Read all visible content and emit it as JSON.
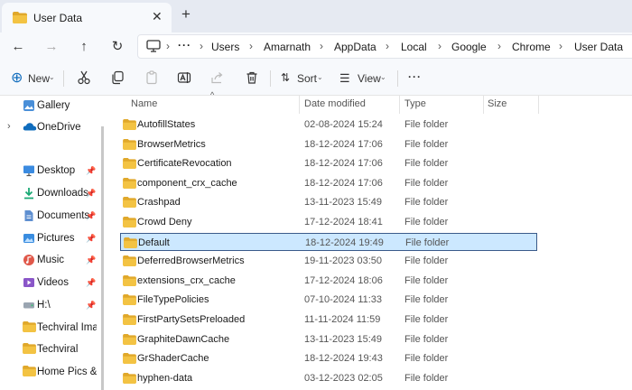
{
  "tab": {
    "title": "User Data"
  },
  "nav": {
    "more_crumbs": "···"
  },
  "breadcrumb": [
    "Users",
    "Amarnath",
    "AppData",
    "Local",
    "Google",
    "Chrome",
    "User Data"
  ],
  "toolbar": {
    "new_label": "New",
    "sort_label": "Sort",
    "view_label": "View",
    "more_label": "···"
  },
  "sidebar": {
    "items": [
      {
        "label": "Gallery",
        "icon": "gallery-icon",
        "pinned": false
      },
      {
        "label": "OneDrive",
        "icon": "cloud-icon",
        "pinned": false,
        "expandable": true
      },
      {
        "label": "Desktop",
        "icon": "desktop-icon",
        "pinned": true
      },
      {
        "label": "Downloads",
        "icon": "download-icon",
        "pinned": true
      },
      {
        "label": "Documents",
        "icon": "documents-icon",
        "pinned": true
      },
      {
        "label": "Pictures",
        "icon": "pictures-icon",
        "pinned": true
      },
      {
        "label": "Music",
        "icon": "music-icon",
        "pinned": true
      },
      {
        "label": "Videos",
        "icon": "videos-icon",
        "pinned": true
      },
      {
        "label": "H:\\",
        "icon": "drive-icon",
        "pinned": true
      },
      {
        "label": "Techviral Image",
        "icon": "folder-icon",
        "pinned": false
      },
      {
        "label": "Techviral",
        "icon": "folder-icon",
        "pinned": false
      },
      {
        "label": "Home Pics & Tc",
        "icon": "folder-icon",
        "pinned": false
      }
    ]
  },
  "columns": {
    "name": "Name",
    "date": "Date modified",
    "type": "Type",
    "size": "Size"
  },
  "files": [
    {
      "name": "AutofillStates",
      "date": "02-08-2024 15:24",
      "type": "File folder"
    },
    {
      "name": "BrowserMetrics",
      "date": "18-12-2024 17:06",
      "type": "File folder"
    },
    {
      "name": "CertificateRevocation",
      "date": "18-12-2024 17:06",
      "type": "File folder"
    },
    {
      "name": "component_crx_cache",
      "date": "18-12-2024 17:06",
      "type": "File folder"
    },
    {
      "name": "Crashpad",
      "date": "13-11-2023 15:49",
      "type": "File folder"
    },
    {
      "name": "Crowd Deny",
      "date": "17-12-2024 18:41",
      "type": "File folder"
    },
    {
      "name": "Default",
      "date": "18-12-2024 19:49",
      "type": "File folder",
      "selected": true
    },
    {
      "name": "DeferredBrowserMetrics",
      "date": "19-11-2023 03:50",
      "type": "File folder"
    },
    {
      "name": "extensions_crx_cache",
      "date": "17-12-2024 18:06",
      "type": "File folder"
    },
    {
      "name": "FileTypePolicies",
      "date": "07-10-2024 11:33",
      "type": "File folder"
    },
    {
      "name": "FirstPartySetsPreloaded",
      "date": "11-11-2024 11:59",
      "type": "File folder"
    },
    {
      "name": "GraphiteDawnCache",
      "date": "13-11-2023 15:49",
      "type": "File folder"
    },
    {
      "name": "GrShaderCache",
      "date": "18-12-2024 19:43",
      "type": "File folder"
    },
    {
      "name": "hyphen-data",
      "date": "03-12-2023 02:05",
      "type": "File folder"
    }
  ],
  "colors": {
    "folder": "#f3c343",
    "folder_dark": "#e0a82b",
    "selection": "#cce8ff",
    "accent": "#0f6cbd"
  }
}
